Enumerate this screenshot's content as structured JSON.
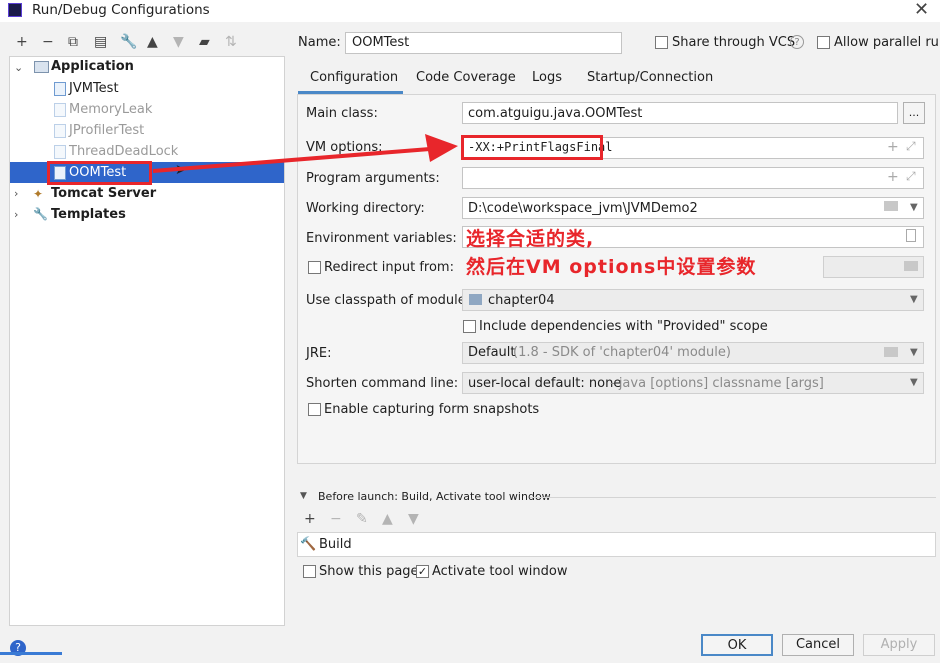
{
  "window": {
    "title": "Run/Debug Configurations"
  },
  "tree": {
    "application": "Application",
    "items": [
      "JVMTest",
      "MemoryLeak",
      "JProfilerTest",
      "ThreadDeadLock",
      "OOMTest"
    ],
    "tomcat": "Tomcat Server",
    "templates": "Templates"
  },
  "name_row": {
    "label": "Name:",
    "value": "OOMTest",
    "share_vcs": "Share through VCS",
    "allow_parallel": "Allow parallel run"
  },
  "tabs": [
    "Configuration",
    "Code Coverage",
    "Logs",
    "Startup/Connection"
  ],
  "form": {
    "main_class_label": "Main class:",
    "main_class_value": "com.atguigu.java.OOMTest",
    "browse_btn": "...",
    "vm_options_label": "VM options:",
    "vm_options_value": "-XX:+PrintFlagsFinal",
    "program_args_label": "Program arguments:",
    "working_dir_label": "Working directory:",
    "working_dir_value": "D:\\code\\workspace_jvm\\JVMDemo2",
    "env_vars_label": "Environment variables:",
    "redirect_input_label": "Redirect input from:",
    "classpath_label": "Use classpath of module:",
    "classpath_value": "chapter04",
    "include_deps": "Include dependencies with \"Provided\" scope",
    "jre_label": "JRE:",
    "jre_value": "Default",
    "jre_hint": "(1.8 - SDK of 'chapter04' module)",
    "shorten_label": "Shorten command line:",
    "shorten_value": "user-local default: none",
    "shorten_hint": "- java [options] classname [args]",
    "capture_snapshots": "Enable capturing form snapshots"
  },
  "annotation": {
    "line1": "选择合适的类,",
    "line2": "然后在VM options中设置参数",
    "color": "#e8262b"
  },
  "before_launch": {
    "header": "Before launch: Build, Activate tool window",
    "task": "Build",
    "show_page": "Show this page",
    "activate_tool": "Activate tool window"
  },
  "buttons": {
    "ok": "OK",
    "cancel": "Cancel",
    "apply": "Apply"
  },
  "help": "?"
}
